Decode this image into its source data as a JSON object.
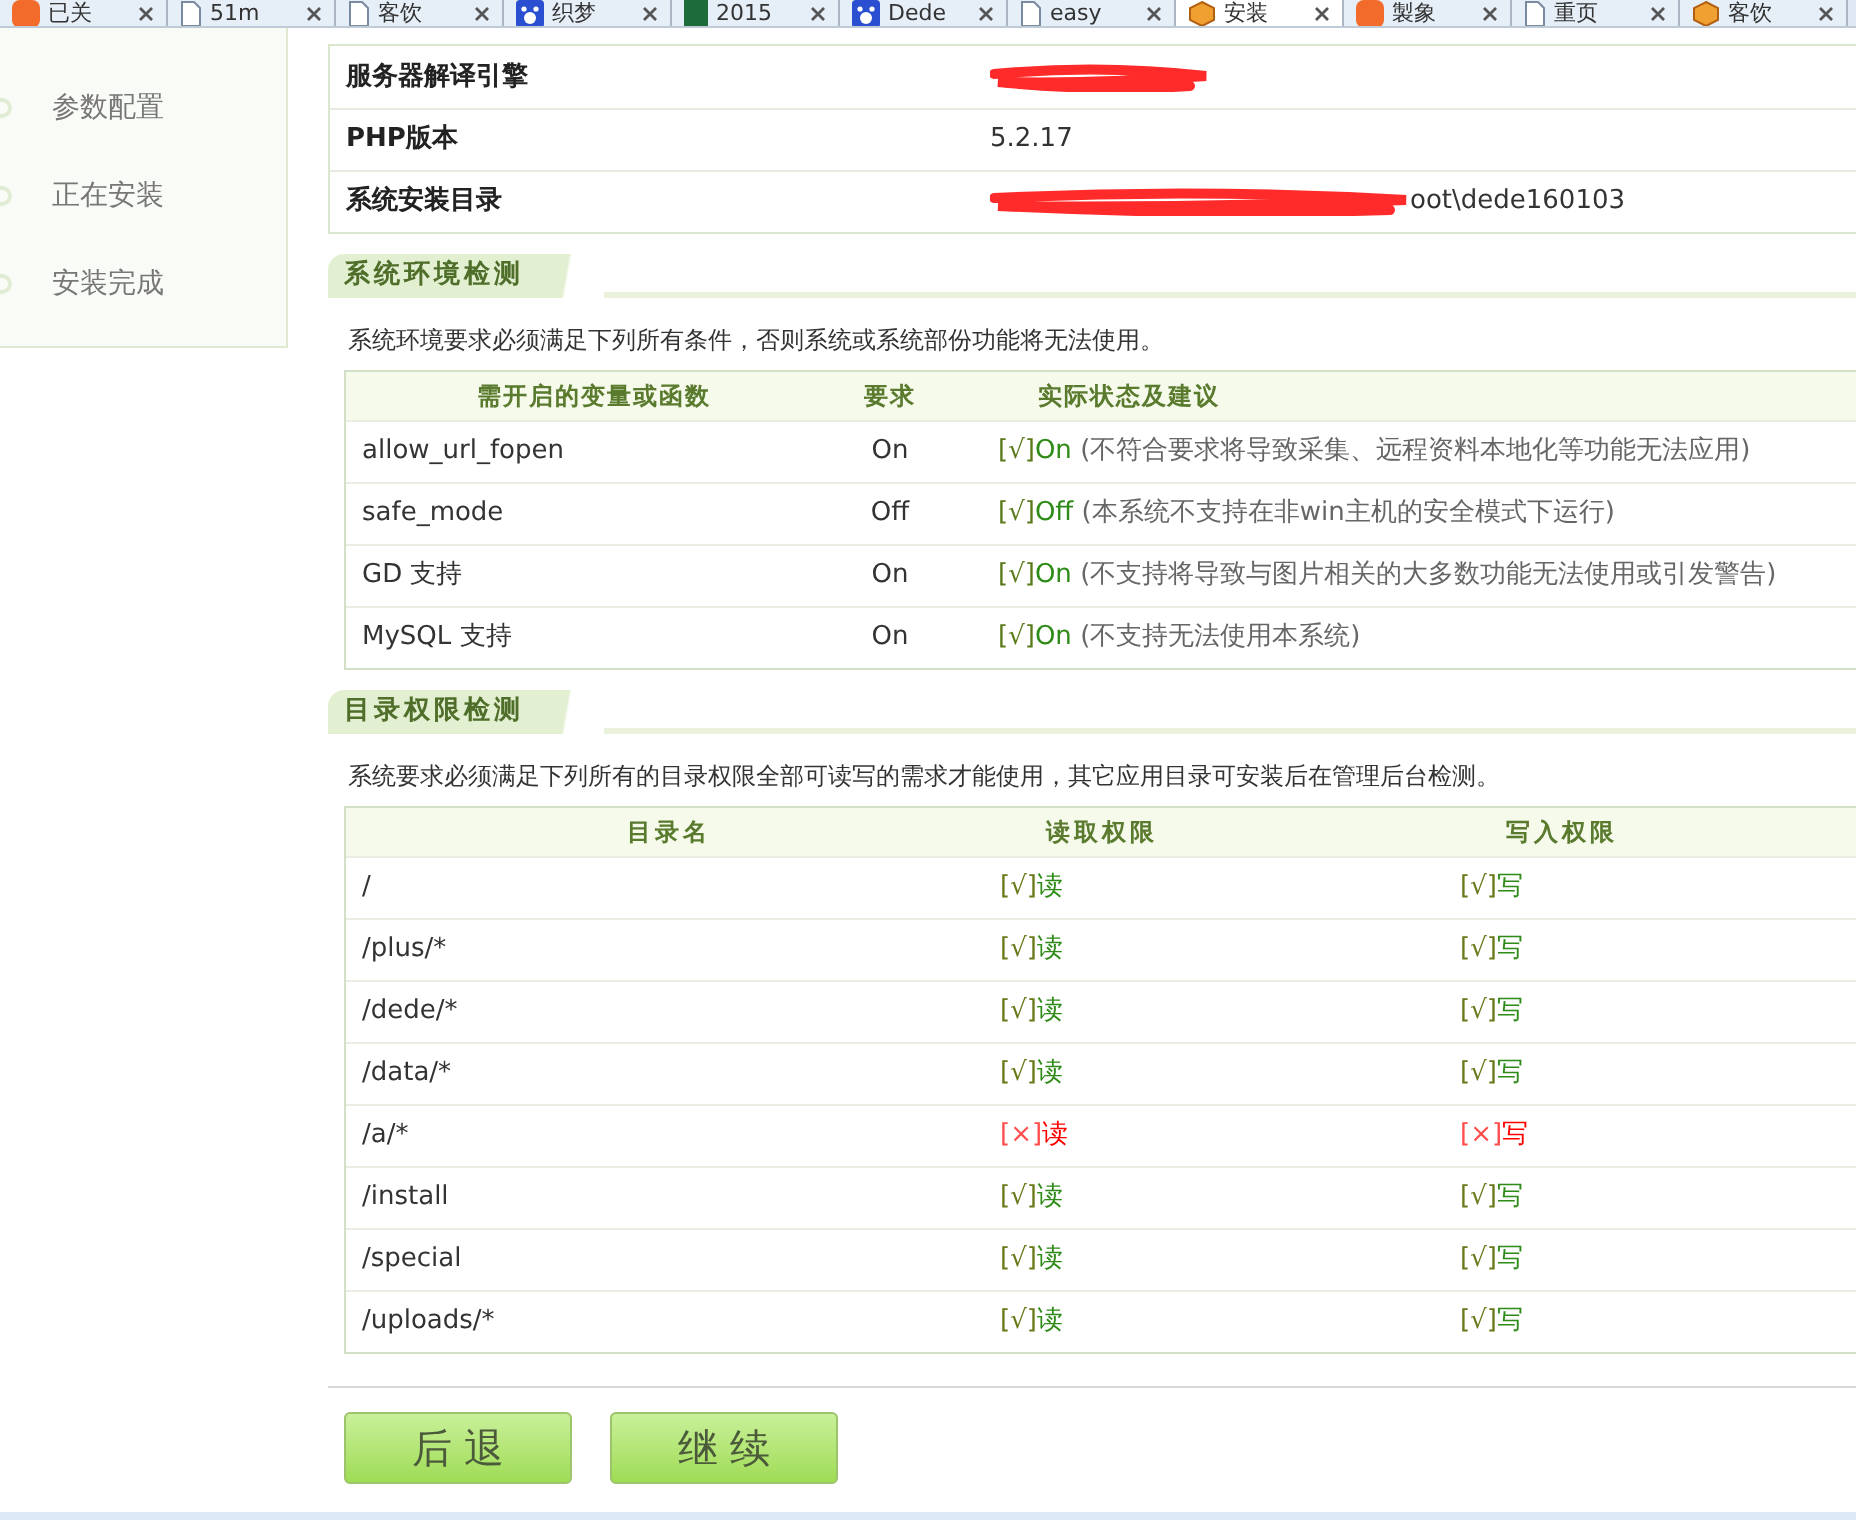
{
  "browser_tabs": [
    {
      "label": "已关",
      "kind": "logo",
      "selected": false
    },
    {
      "label": "51m",
      "kind": "page",
      "selected": false
    },
    {
      "label": "客饮",
      "kind": "page",
      "selected": false
    },
    {
      "label": "织梦",
      "kind": "paw",
      "selected": false
    },
    {
      "label": "2015",
      "kind": "book",
      "selected": false
    },
    {
      "label": "Dede",
      "kind": "paw",
      "selected": false
    },
    {
      "label": "easy",
      "kind": "page",
      "selected": false
    },
    {
      "label": "安装",
      "kind": "cube",
      "selected": true
    },
    {
      "label": "製象",
      "kind": "logo",
      "selected": false
    },
    {
      "label": "重页",
      "kind": "page",
      "selected": false
    },
    {
      "label": "客饮",
      "kind": "cube",
      "selected": false
    }
  ],
  "sidebar": {
    "items": [
      {
        "label": "参数配置"
      },
      {
        "label": "正在安装"
      },
      {
        "label": "安装完成"
      }
    ]
  },
  "server_info": [
    {
      "label": "服务器解译引擎",
      "redacted": true
    },
    {
      "label": "PHP版本",
      "value": "5.2.17",
      "redacted": false
    },
    {
      "label": "系统安装目录",
      "value": "oot\\dede160103",
      "redacted": true
    }
  ],
  "env_check": {
    "title": "系统环境检测",
    "description": "系统环境要求必须满足下列所有条件，否则系统或系统部份功能将无法使用。",
    "columns": [
      "需开启的变量或函数",
      "要求",
      "实际状态及建议"
    ],
    "rows": [
      {
        "name": "allow_url_fopen",
        "required": "On",
        "mark": "[√]",
        "status": "On",
        "ok": true,
        "note": "(不符合要求将导致采集、远程资料本地化等功能无法应用)"
      },
      {
        "name": "safe_mode",
        "required": "Off",
        "mark": "[√]",
        "status": "Off",
        "ok": true,
        "note": "(本系统不支持在非win主机的安全模式下运行)"
      },
      {
        "name": "GD 支持",
        "required": "On",
        "mark": "[√]",
        "status": "On",
        "ok": true,
        "note": "(不支持将导致与图片相关的大多数功能无法使用或引发警告)"
      },
      {
        "name": "MySQL 支持",
        "required": "On",
        "mark": "[√]",
        "status": "On",
        "ok": true,
        "note": "(不支持无法使用本系统)"
      }
    ]
  },
  "dir_check": {
    "title": "目录权限检测",
    "description": "系统要求必须满足下列所有的目录权限全部可读写的需求才能使用，其它应用目录可安装后在管理后台检测。",
    "columns": [
      "目录名",
      "读取权限",
      "写入权限"
    ],
    "rows": [
      {
        "path": "/",
        "read": {
          "mark": "[√]",
          "label": "读",
          "ok": true
        },
        "write": {
          "mark": "[√]",
          "label": "写",
          "ok": true
        }
      },
      {
        "path": "/plus/*",
        "read": {
          "mark": "[√]",
          "label": "读",
          "ok": true
        },
        "write": {
          "mark": "[√]",
          "label": "写",
          "ok": true
        }
      },
      {
        "path": "/dede/*",
        "read": {
          "mark": "[√]",
          "label": "读",
          "ok": true
        },
        "write": {
          "mark": "[√]",
          "label": "写",
          "ok": true
        }
      },
      {
        "path": "/data/*",
        "read": {
          "mark": "[√]",
          "label": "读",
          "ok": true
        },
        "write": {
          "mark": "[√]",
          "label": "写",
          "ok": true
        }
      },
      {
        "path": "/a/*",
        "read": {
          "mark": "[×]",
          "label": "读",
          "ok": false
        },
        "write": {
          "mark": "[×]",
          "label": "写",
          "ok": false
        }
      },
      {
        "path": "/install",
        "read": {
          "mark": "[√]",
          "label": "读",
          "ok": true
        },
        "write": {
          "mark": "[√]",
          "label": "写",
          "ok": true
        }
      },
      {
        "path": "/special",
        "read": {
          "mark": "[√]",
          "label": "读",
          "ok": true
        },
        "write": {
          "mark": "[√]",
          "label": "写",
          "ok": true
        }
      },
      {
        "path": "/uploads/*",
        "read": {
          "mark": "[√]",
          "label": "读",
          "ok": true
        },
        "write": {
          "mark": "[√]",
          "label": "写",
          "ok": true
        }
      }
    ]
  },
  "buttons": [
    "后 退",
    "继 续"
  ]
}
